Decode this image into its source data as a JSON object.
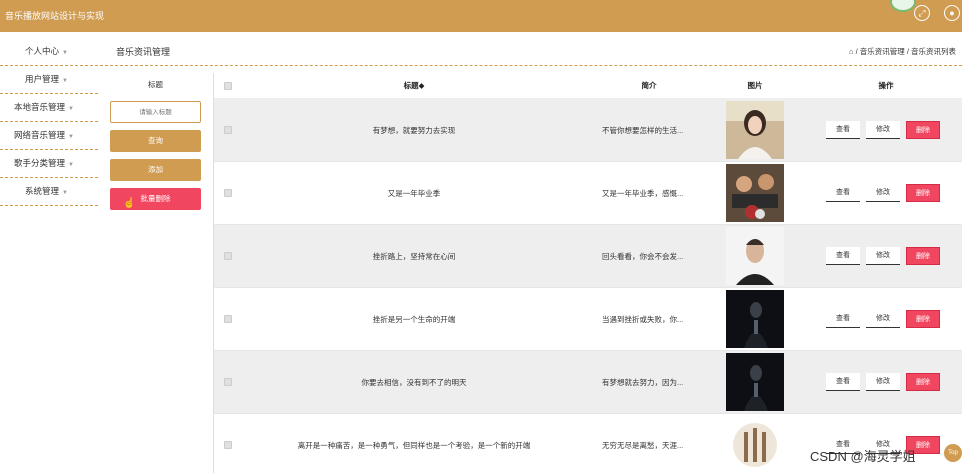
{
  "app": {
    "title": "音乐播放网站设计与实现"
  },
  "header": {
    "expand_icon": "expand-icon",
    "user_icon": "user-icon",
    "logo_icon": "logo-badge"
  },
  "sidebar": {
    "items": [
      {
        "label": "个人中心"
      },
      {
        "label": "用户管理"
      },
      {
        "label": "本地音乐管理"
      },
      {
        "label": "网络音乐管理"
      },
      {
        "label": "歌手分类管理"
      },
      {
        "label": "系统管理"
      }
    ]
  },
  "page": {
    "title": "音乐资讯管理",
    "breadcrumb": "/ 音乐资讯管理 / 音乐资讯列表",
    "home_icon": "home-icon"
  },
  "search": {
    "label": "标题",
    "placeholder": "请输入标题",
    "query_button": "查询",
    "add_button": "添加",
    "batch_delete_button": "批量删除"
  },
  "table": {
    "headers": {
      "title": "标题◆",
      "intro": "简介",
      "image": "图片",
      "ops": "操作"
    },
    "rows": [
      {
        "title": "有梦想，就要努力去实现",
        "intro": "不管你想要怎样的生活...",
        "view": "查看",
        "edit": "修改",
        "delete": "删除"
      },
      {
        "title": "又是一年毕业季",
        "intro": "又是一年毕业季，感慨...",
        "view": "查看",
        "edit": "修改",
        "delete": "删除"
      },
      {
        "title": "挫折路上，坚持常在心间",
        "intro": "回头看看，你会不会发...",
        "view": "查看",
        "edit": "修改",
        "delete": "删除"
      },
      {
        "title": "挫折是另一个生命的开端",
        "intro": "当遇到挫折或失败，你...",
        "view": "查看",
        "edit": "修改",
        "delete": "删除"
      },
      {
        "title": "你要去相信，没有到不了的明天",
        "intro": "有梦想就去努力，因为...",
        "view": "查看",
        "edit": "修改",
        "delete": "删除"
      },
      {
        "title": "离开是一种痛苦，是一种勇气，但同样也是一个考验，是一个新的开端",
        "intro": "无穷无尽是离愁，天涯...",
        "view": "查看",
        "edit": "修改",
        "delete": "删除"
      }
    ]
  },
  "footer": {
    "watermark": "CSDN @海灵学姐",
    "top_button": "Top"
  },
  "colors": {
    "accent": "#d09c52",
    "danger": "#f14660"
  }
}
